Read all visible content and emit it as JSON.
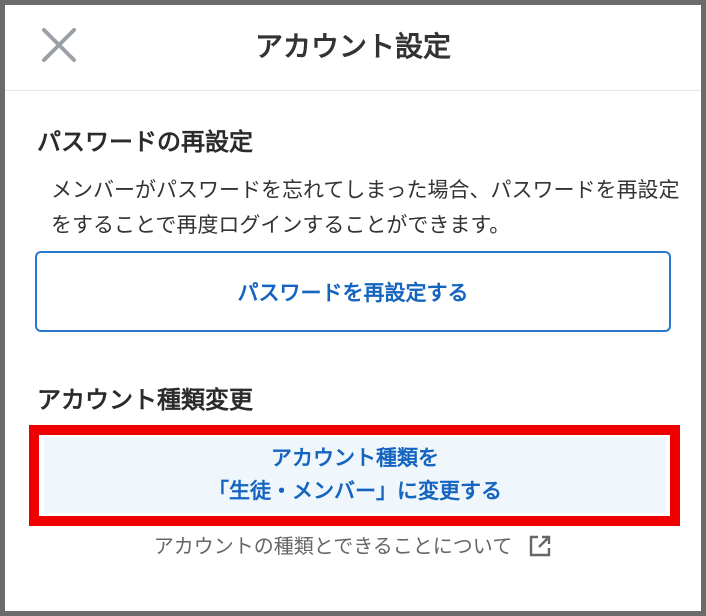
{
  "header": {
    "title": "アカウント設定",
    "close_icon": "close-icon"
  },
  "password_section": {
    "heading": "パスワードの再設定",
    "description": "メンバーがパスワードを忘れてしまった場合、パスワードを再設定をすることで再度ログインすることができます。",
    "button_label": "パスワードを再設定する"
  },
  "account_type_section": {
    "heading": "アカウント種類変更",
    "button_line1": "アカウント種類を",
    "button_line2": "「生徒・メンバー」に変更する",
    "info_link": "アカウントの種類とできることについて",
    "info_link_icon": "external-link-icon"
  },
  "colors": {
    "accent": "#1565c0",
    "button_bg": "#eff7fd",
    "highlight": "#ee0000",
    "frame_border": "#6b6b6b"
  }
}
